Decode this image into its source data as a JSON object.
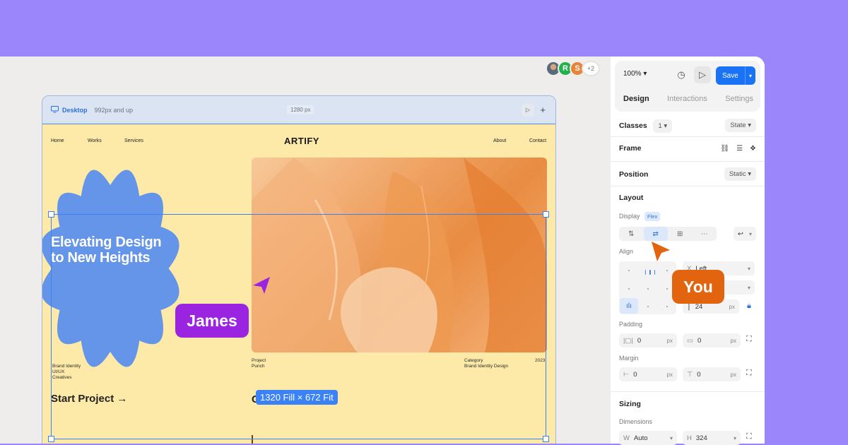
{
  "colors": {
    "background": "#9b87fb",
    "accent": "#1a73f5",
    "selection": "#3b82f6",
    "james": "#9b24e0",
    "you": "#e3640e",
    "flower": "#6495e8",
    "page": "#fdeaa8"
  },
  "collaborators": {
    "avatars": [
      "R",
      "S"
    ],
    "more": "+2"
  },
  "canvas": {
    "breakpoint": {
      "device": "Desktop",
      "range": "992px and up",
      "width": "1280 px"
    },
    "site": {
      "nav_left": [
        "Home",
        "Works",
        "Services"
      ],
      "logo": "ARTIFY",
      "nav_right": [
        "About",
        "Contact"
      ],
      "hero_title": "Elevating Design to New Heights",
      "tags": [
        "Brand Identity",
        "UI/UX",
        "Creatives"
      ],
      "project_label": "Project",
      "project_value": "Punch",
      "category_label": "Category",
      "category_value": "Brand Identity Design",
      "year": "2023",
      "start_project": "Start Project",
      "start_arrow": "→",
      "second_heading_initial": "C"
    },
    "selection_size": "1320 Fill × 672 Fit"
  },
  "cursors": {
    "james": "James",
    "you": "You"
  },
  "panel": {
    "zoom": "100%",
    "save": "Save",
    "tabs": [
      "Design",
      "Interactions",
      "Settings"
    ],
    "classes": {
      "label": "Classes",
      "count": "1",
      "state": "State"
    },
    "frame": "Frame",
    "position": {
      "label": "Position",
      "value": "Static"
    },
    "layout": {
      "label": "Layout",
      "display_label": "Display",
      "display_value": "Flex",
      "align_label": "Align",
      "x_value": "Left",
      "gap_value": "24",
      "gap_unit": "px"
    },
    "padding": {
      "label": "Padding",
      "horizontal": "0",
      "vertical": "0",
      "unit": "px"
    },
    "margin": {
      "label": "Margin",
      "horizontal": "0",
      "vertical": "0",
      "unit": "px"
    },
    "sizing": {
      "label": "Sizing",
      "dimensions_label": "Dimensions",
      "w_label": "W",
      "w_value": "Auto",
      "h_label": "H",
      "h_value": "324"
    }
  }
}
